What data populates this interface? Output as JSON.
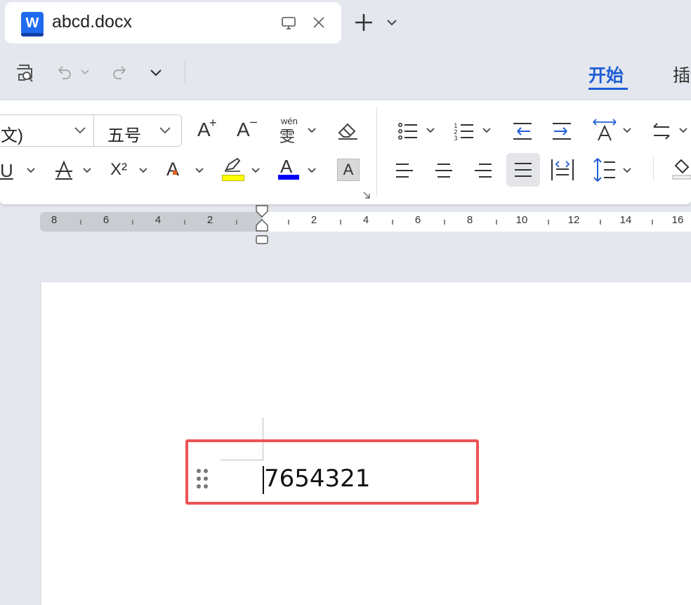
{
  "tab": {
    "app_logo": "W",
    "title": "abcd.docx"
  },
  "menu": {
    "active": "开始",
    "next_partial": "插"
  },
  "font": {
    "name_partial": "文)",
    "size": "五号"
  },
  "ribbon_labels": {
    "grow": "A",
    "shrink": "A",
    "phonetic": "wén",
    "phonetic_char": "雯",
    "superscript": "X²",
    "effect": "A",
    "font_color": "A",
    "char_shading": "A"
  },
  "ruler": {
    "left_ticks": [
      "8",
      "6",
      "4",
      "2"
    ],
    "right_ticks": [
      "2",
      "4",
      "6",
      "8",
      "10",
      "12",
      "14",
      "16"
    ]
  },
  "document": {
    "text": "7654321"
  },
  "colors": {
    "accent": "#1f5ed6",
    "highlight": "#ffff00",
    "font_color": "#0000ff",
    "selection_border": "#f05454"
  },
  "icons": [
    "monitor-icon",
    "close-icon",
    "plus-icon",
    "chevron-down-icon",
    "print-preview-icon",
    "undo-icon",
    "redo-icon",
    "eraser-icon",
    "bullets-icon",
    "numbering-icon",
    "outdent-icon",
    "indent-icon",
    "text-direction-icon",
    "swap-icon",
    "underline-icon",
    "strikethrough-icon",
    "align-left-icon",
    "align-center-icon",
    "align-right-icon",
    "justify-icon",
    "distribute-icon",
    "line-spacing-icon",
    "drag-handle-icon"
  ]
}
